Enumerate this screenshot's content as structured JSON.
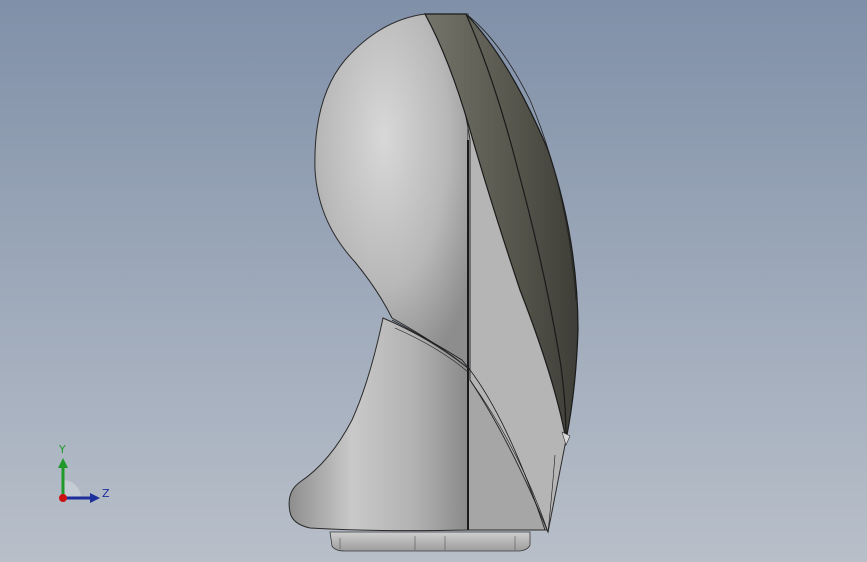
{
  "window": {
    "title": ""
  },
  "viewport": {
    "background_top": "#8090a8",
    "background_bottom": "#b8bfc9",
    "model": {
      "description": "",
      "colors": {
        "body_light": "#d6d6d6",
        "body_mid": "#a9a9a9",
        "body_dark": "#7c7c7c",
        "face_dark": "#4a4a42",
        "face_mid": "#6b6b62",
        "edge": "#1a1a1a"
      }
    },
    "triad": {
      "y_label": "Y",
      "z_label": "Z",
      "y_color": "#1f9a2a",
      "z_color": "#1c2f9a",
      "origin_color": "#cc1010"
    }
  }
}
